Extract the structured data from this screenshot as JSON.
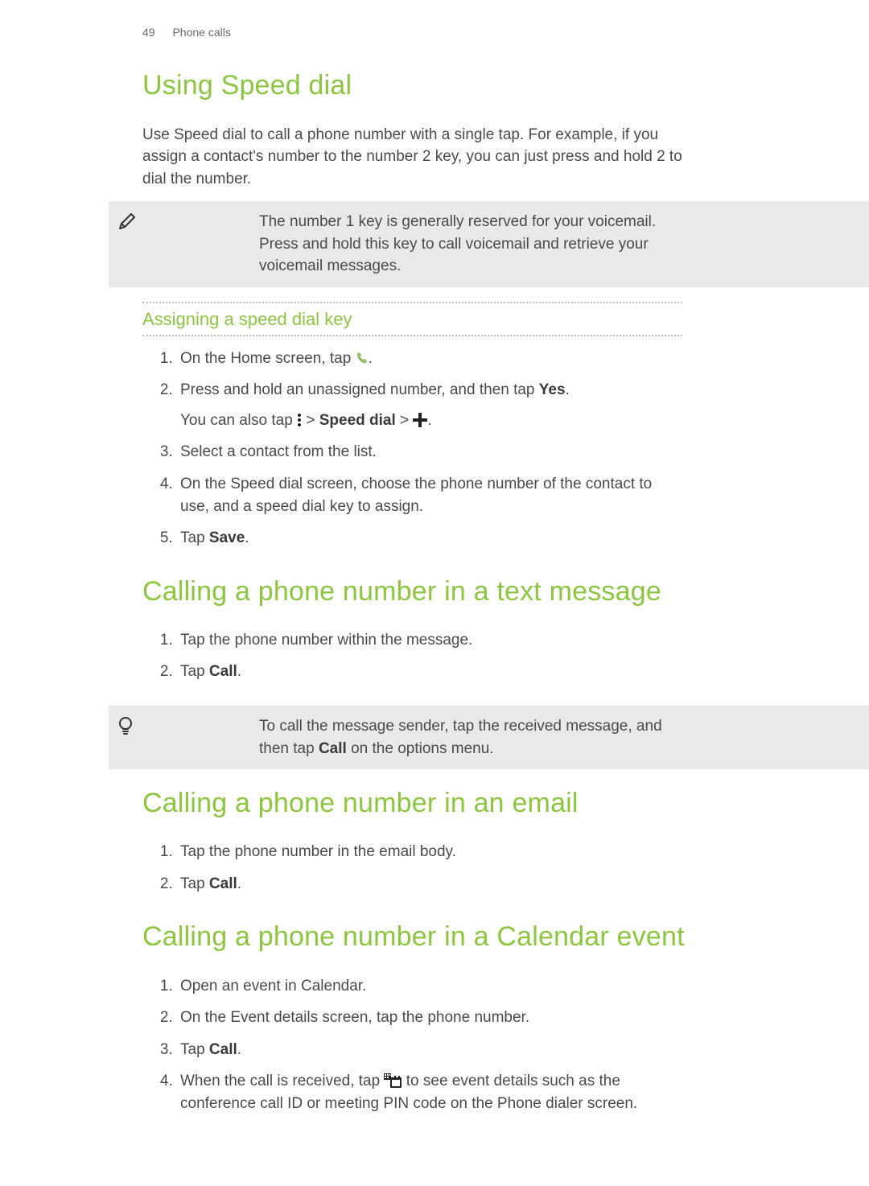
{
  "header": {
    "page_number": "49",
    "section": "Phone calls"
  },
  "sections": {
    "speed_dial": {
      "title": "Using Speed dial",
      "intro": "Use Speed dial to call a phone number with a single tap. For example, if you assign a contact's number to the number 2 key, you can just press and hold 2 to dial the number.",
      "note": "The number 1 key is generally reserved for your voicemail. Press and hold this key to call voicemail and retrieve your voicemail messages.",
      "subheading": "Assigning a speed dial key",
      "steps": {
        "s1_pre": "On the Home screen, tap ",
        "s1_post": ".",
        "s2_line": "Press and hold an unassigned number, and then tap ",
        "s2_bold": "Yes",
        "s2_end": ".",
        "s2_sub_pre": "You can also tap ",
        "s2_sub_mid1": " > ",
        "s2_sub_bold": "Speed dial",
        "s2_sub_mid2": " > ",
        "s2_sub_post": ".",
        "s3": "Select a contact from the list.",
        "s4": "On the Speed dial screen, choose the phone number of the contact to use, and a speed dial key to assign.",
        "s5_pre": "Tap ",
        "s5_bold": "Save",
        "s5_post": "."
      }
    },
    "text_msg": {
      "title": "Calling a phone number in a text message",
      "steps": {
        "s1": "Tap the phone number within the message.",
        "s2_pre": "Tap ",
        "s2_bold": "Call",
        "s2_post": "."
      },
      "tip_pre": "To call the message sender, tap the received message, and then tap ",
      "tip_bold": "Call",
      "tip_post": " on the options menu."
    },
    "email": {
      "title": "Calling a phone number in an email",
      "steps": {
        "s1": "Tap the phone number in the email body.",
        "s2_pre": "Tap ",
        "s2_bold": "Call",
        "s2_post": "."
      }
    },
    "calendar": {
      "title": "Calling a phone number in a Calendar event",
      "steps": {
        "s1": "Open an event in Calendar.",
        "s2": "On the Event details screen, tap the phone number.",
        "s3_pre": "Tap ",
        "s3_bold": "Call",
        "s3_post": ".",
        "s4_pre": "When the call is received, tap ",
        "s4_post": " to see event details such as the conference call ID or meeting PIN code on the Phone dialer screen."
      }
    }
  }
}
